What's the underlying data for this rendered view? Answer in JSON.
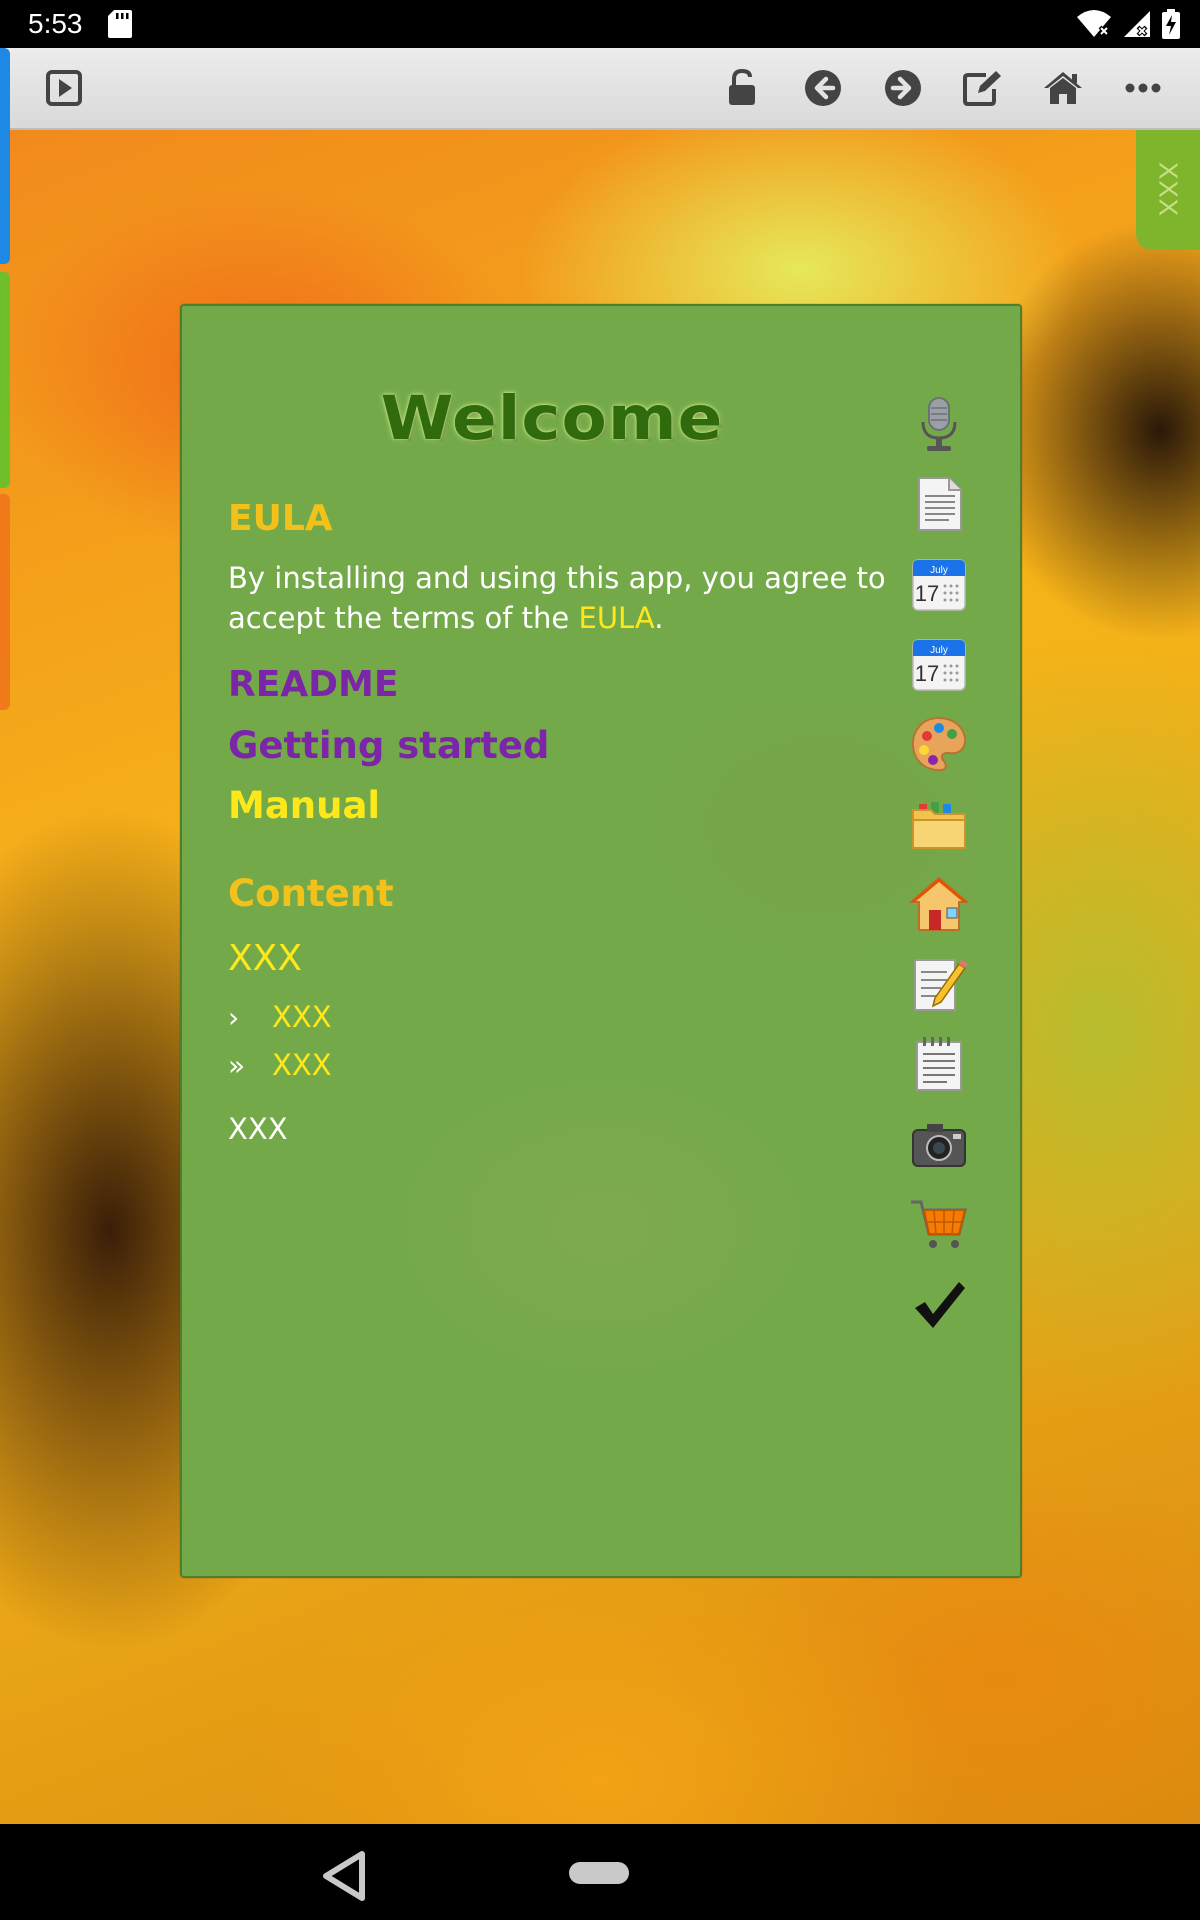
{
  "status_bar": {
    "time": "5:53",
    "icons": [
      "sd-card-icon",
      "wifi-off-icon",
      "signal-off-icon",
      "battery-charging-icon"
    ]
  },
  "toolbar": {
    "buttons": [
      "play-icon",
      "lock-open-icon",
      "back-arrow-icon",
      "forward-arrow-icon",
      "edit-icon",
      "home-icon",
      "more-icon"
    ]
  },
  "side_tab": {
    "label": "XXX"
  },
  "panel": {
    "title": "Welcome",
    "eula_heading": "EULA",
    "eula_text_before": "By installing and using this app, you agree to accept the terms of the ",
    "eula_link": "EULA",
    "eula_text_after": ".",
    "readme": "README",
    "getting_started": "Getting started",
    "manual": "Manual",
    "content_heading": "Content",
    "xxx_heading": "XXX",
    "bullet_items": [
      {
        "bullet": "›",
        "label": "XXX"
      },
      {
        "bullet": "»",
        "label": "XXX"
      }
    ],
    "xxx_plain": "XXX",
    "icons": [
      "microphone-icon",
      "document-icon",
      "calendar-icon",
      "calendar-icon",
      "palette-icon",
      "folder-icon",
      "house-icon",
      "memo-icon",
      "notepad-icon",
      "camera-icon",
      "shopping-cart-icon",
      "check-mark-icon"
    ],
    "calendar_month": "July",
    "calendar_day": "17"
  },
  "colors": {
    "panel_bg": "#74a94a",
    "title": "#2f6a0c",
    "heading_gold": "#f2c21b",
    "link_yellow": "#ffe81a",
    "link_purple": "#7b26a8",
    "side_tab": "#7fb52c"
  }
}
